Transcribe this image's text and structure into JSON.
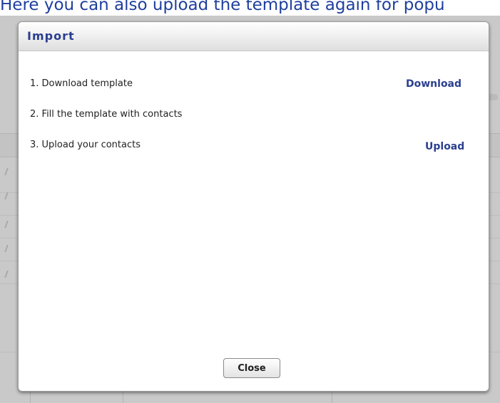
{
  "caption": "Here you can also upload the template again for popu",
  "dialog": {
    "title": "Import",
    "steps": [
      {
        "text": "1. Download template",
        "action": "Download"
      },
      {
        "text": "2. Fill the template with contacts",
        "action": ""
      },
      {
        "text": "3. Upload your contacts",
        "action": "Upload"
      }
    ],
    "close_label": "Close"
  },
  "colors": {
    "accent": "#2b3f8f",
    "caption": "#1f3f9e",
    "overlay": "#c9c9c9"
  }
}
